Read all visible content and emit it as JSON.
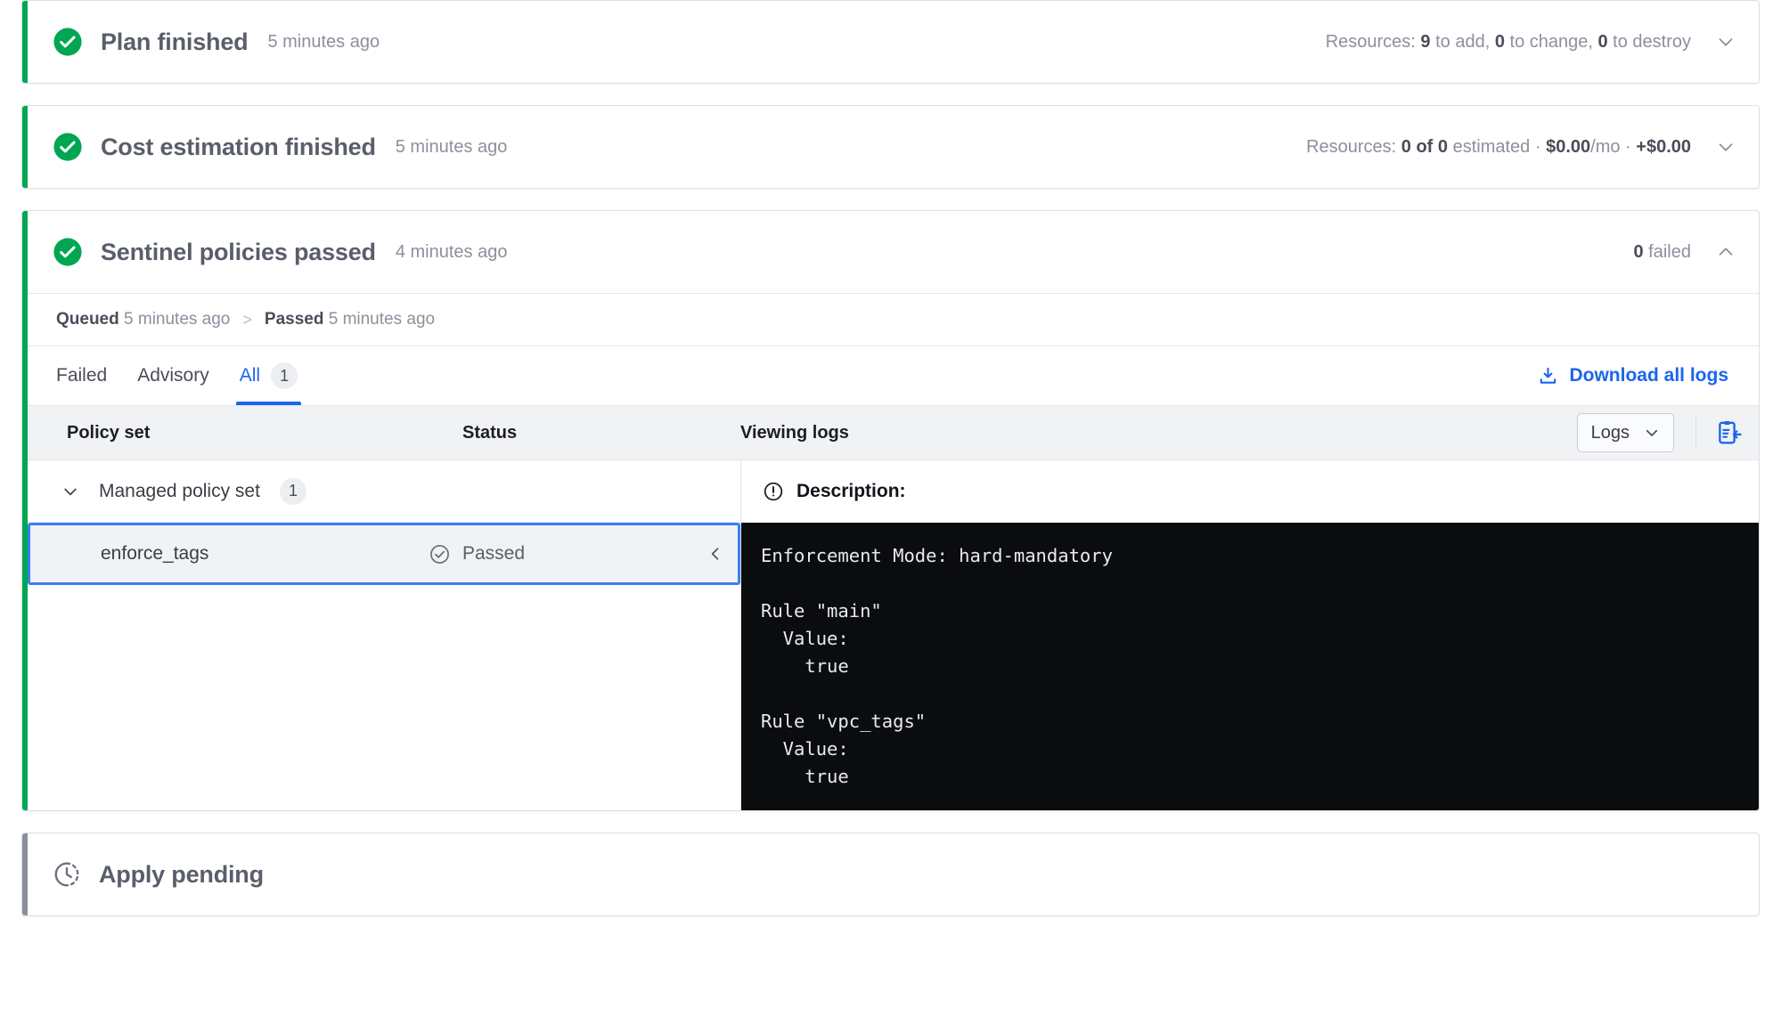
{
  "cards": {
    "plan": {
      "title": "Plan finished",
      "time": "5 minutes ago",
      "meta_prefix": "Resources: ",
      "meta_add": "9",
      "meta_add_suffix": " to add, ",
      "meta_change": "0",
      "meta_change_suffix": " to change, ",
      "meta_destroy": "0",
      "meta_destroy_suffix": " to destroy",
      "status_icon": "check-circle-filled-icon",
      "chevron": "chevron-down-icon",
      "accent_color": "#00a651"
    },
    "cost": {
      "title": "Cost estimation finished",
      "time": "5 minutes ago",
      "meta_prefix": "Resources: ",
      "meta_estimated": "0 of 0",
      "meta_estimated_suffix": " estimated · ",
      "meta_price": "$0.00",
      "meta_price_suffix": "/mo · ",
      "meta_delta": "+$0.00",
      "status_icon": "check-circle-filled-icon",
      "chevron": "chevron-down-icon",
      "accent_color": "#00a651"
    },
    "sentinel": {
      "title": "Sentinel policies passed",
      "time": "4 minutes ago",
      "failed_count": "0",
      "failed_label": " failed",
      "chevron": "chevron-up-icon",
      "status_icon": "check-circle-filled-icon",
      "accent_color": "#00a651",
      "timeline": {
        "queued_label": "Queued",
        "queued_time": "5 minutes ago",
        "separator": ">",
        "passed_label": "Passed",
        "passed_time": "5 minutes ago"
      },
      "tabs": [
        {
          "label": "Failed",
          "count": null,
          "active": false
        },
        {
          "label": "Advisory",
          "count": null,
          "active": false
        },
        {
          "label": "All",
          "count": "1",
          "active": true
        }
      ],
      "download_link": "Download all logs",
      "download_icon": "download-icon",
      "table": {
        "columns": [
          "Policy set",
          "Status",
          "Viewing logs"
        ],
        "logs_select_value": "Logs",
        "logs_select_icon": "chevron-down-icon",
        "panel_icon": "open-in-panel-icon",
        "group": {
          "name": "Managed policy set",
          "count": "1",
          "expanded": true,
          "chevron": "chevron-down-icon"
        },
        "rows": [
          {
            "name": "enforce_tags",
            "status": "Passed",
            "status_icon": "check-circle-outline-icon",
            "row_chevron": "chevron-left-icon",
            "selected": true
          }
        ]
      },
      "description": {
        "heading": "Description:",
        "heading_icon": "exclamation-circle-icon",
        "log": "Enforcement Mode: hard-mandatory\n\nRule \"main\"\n  Value:\n    true\n\nRule \"vpc_tags\"\n  Value:\n    true"
      }
    },
    "apply": {
      "title": "Apply pending",
      "status_icon": "clock-pending-icon",
      "accent_color": "#8c909c"
    }
  },
  "colors": {
    "accent_green": "#00a651",
    "accent_grey": "#8c909c",
    "link_blue": "#1b65f0",
    "focus_blue": "#3b7ef5",
    "terminal_bg": "#0b0c0e"
  }
}
